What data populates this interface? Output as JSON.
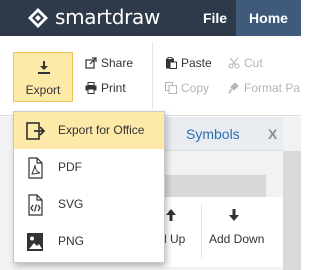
{
  "header": {
    "brand": "smartdraw",
    "menu": {
      "file": "File",
      "home": "Home"
    }
  },
  "ribbon": {
    "export_label": "Export",
    "share_label": "Share",
    "print_label": "Print",
    "paste_label": "Paste",
    "cut_label": "Cut",
    "copy_label": "Copy",
    "format_painter_label": "Format Pa"
  },
  "panel": {
    "symbols_label": "Symbols",
    "close_label": "X",
    "move_up_label": "d Up",
    "add_down_label": "Add Down"
  },
  "export_menu": {
    "items": [
      {
        "label": "Export for Office",
        "icon": "export-office-icon",
        "active": true
      },
      {
        "label": "PDF",
        "icon": "pdf-file-icon",
        "active": false
      },
      {
        "label": "SVG",
        "icon": "svg-file-icon",
        "active": false
      },
      {
        "label": "PNG",
        "icon": "png-image-icon",
        "active": false
      }
    ]
  },
  "colors": {
    "topbar": "#2e3a4a",
    "home_tab": "#3f5a7a",
    "highlight": "#fde9a8",
    "link_blue": "#2a6fb0"
  }
}
